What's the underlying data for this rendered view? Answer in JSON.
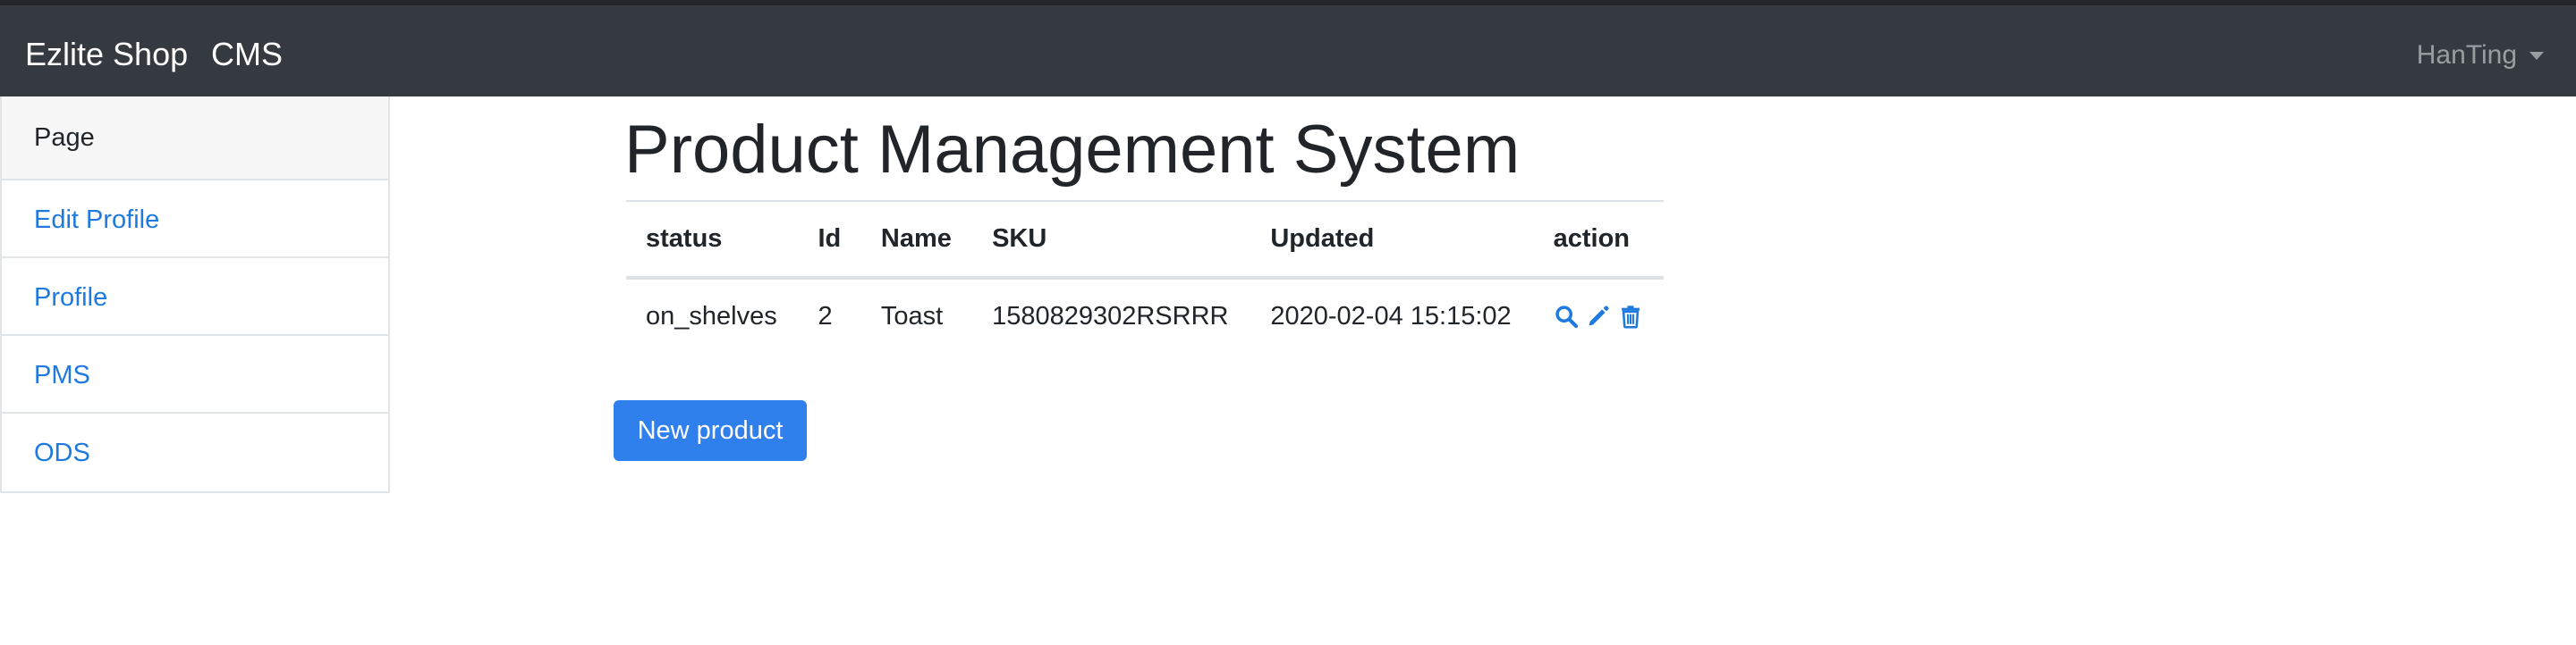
{
  "navbar": {
    "brand": "Ezlite Shop",
    "cms_link": "CMS",
    "user": "HanTing"
  },
  "sidebar": {
    "header": "Page",
    "items": [
      {
        "label": "Edit Profile"
      },
      {
        "label": "Profile"
      },
      {
        "label": "PMS"
      },
      {
        "label": "ODS"
      }
    ]
  },
  "main": {
    "title": "Product Management System",
    "table": {
      "columns": [
        "status",
        "Id",
        "Name",
        "SKU",
        "Updated",
        "action"
      ],
      "rows": [
        {
          "status": "on_shelves",
          "id": "2",
          "name": "Toast",
          "sku": "1580829302RSRRR",
          "updated": "2020-02-04 15:15:02",
          "actions": [
            "search-icon",
            "pencil-icon",
            "trash-icon"
          ]
        }
      ]
    },
    "new_button": "New product"
  },
  "colors": {
    "navbar_bg": "#343a40",
    "link": "#1f7ae0",
    "primary_button": "#2f80ed"
  }
}
